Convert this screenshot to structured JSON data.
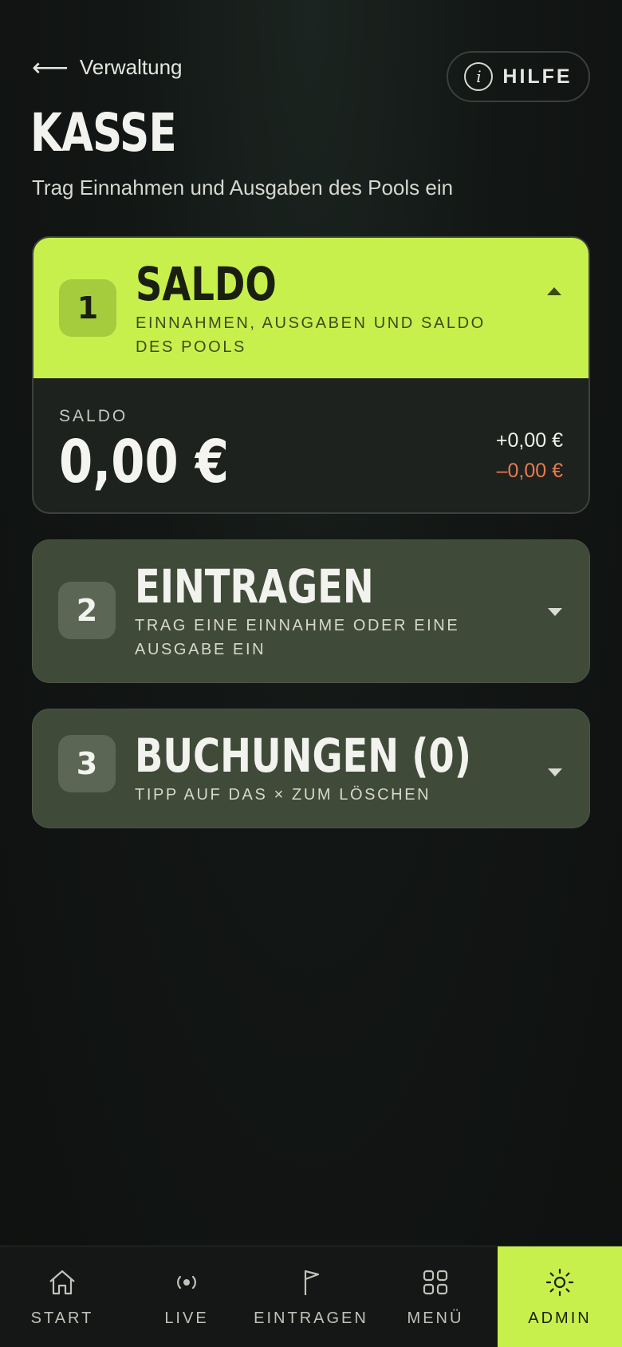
{
  "header": {
    "back_arrow": "⟵",
    "back_label": "Verwaltung",
    "help_icon_glyph": "i",
    "help_label": "HILFE",
    "title": "KASSE",
    "subtitle": "Trag Einnahmen und Ausgaben des Pools ein"
  },
  "sections": [
    {
      "number": "1",
      "title": "SALDO",
      "description": "EINNAHMEN, AUSGABEN UND SALDO DES POOLS",
      "expanded": true,
      "body": {
        "label": "SALDO",
        "value": "0,00 €",
        "income": "+0,00 €",
        "expenses": "–0,00 €"
      }
    },
    {
      "number": "2",
      "title": "EINTRAGEN",
      "description": "TRAG EINE EINNAHME ODER EINE AUSGABE EIN",
      "expanded": false
    },
    {
      "number": "3",
      "title": "BUCHUNGEN (0)",
      "description": "TIPP AUF DAS × ZUM LÖSCHEN",
      "expanded": false
    }
  ],
  "nav": [
    {
      "label": "START",
      "icon": "home-icon",
      "active": false
    },
    {
      "label": "LIVE",
      "icon": "live-broadcast-icon",
      "active": false
    },
    {
      "label": "EINTRAGEN",
      "icon": "flag-icon",
      "active": false
    },
    {
      "label": "MENÜ",
      "icon": "grid-icon",
      "active": false
    },
    {
      "label": "ADMIN",
      "icon": "sun-icon",
      "active": true
    }
  ],
  "colors": {
    "accent": "#c8f04c",
    "background": "#121614",
    "card_dark": "#3f4a38",
    "negative": "#e87a50"
  }
}
